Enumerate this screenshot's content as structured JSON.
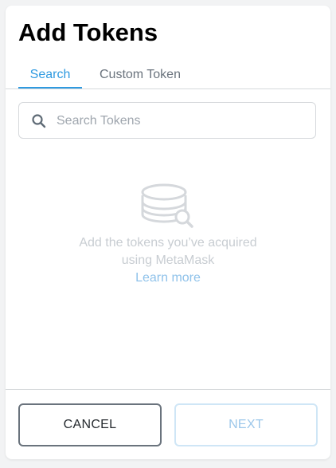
{
  "modal": {
    "title": "Add Tokens"
  },
  "tabs": [
    {
      "label": "Search",
      "active": true
    },
    {
      "label": "Custom Token",
      "active": false
    }
  ],
  "search": {
    "placeholder": "Search Tokens",
    "value": "",
    "icon": "search-icon"
  },
  "empty_state": {
    "icon": "coins-search-icon",
    "message": "Add the tokens you’ve acquired using MetaMask",
    "link": "Learn more"
  },
  "footer": {
    "cancel_label": "CANCEL",
    "next_label": "NEXT",
    "next_enabled": false
  },
  "colors": {
    "accent": "#2f9ae0",
    "border": "#d6d9dc",
    "muted_text": "#6a737d"
  }
}
